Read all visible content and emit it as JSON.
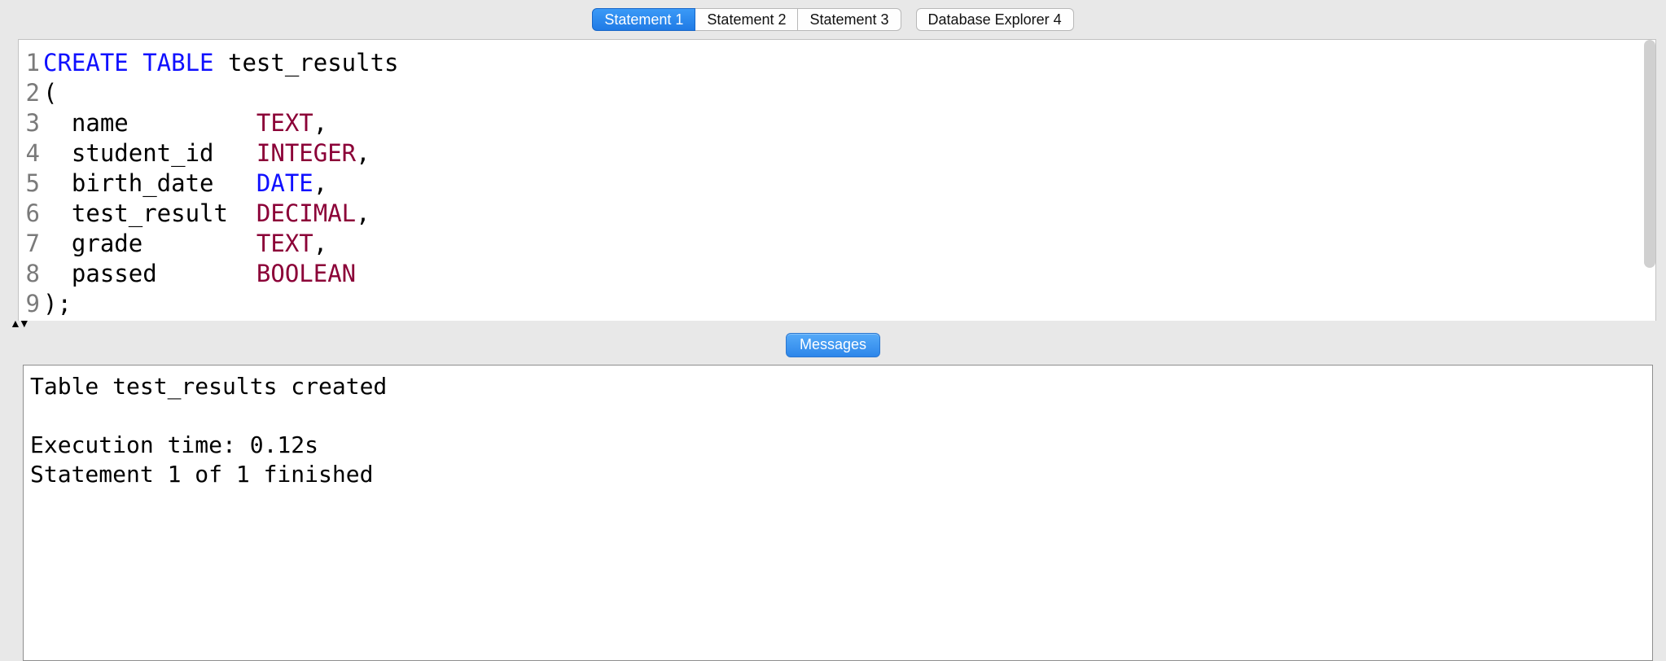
{
  "tabs": {
    "group1": [
      {
        "label": "Statement 1",
        "active": true
      },
      {
        "label": "Statement 2",
        "active": false
      },
      {
        "label": "Statement 3",
        "active": false
      }
    ],
    "group2": [
      {
        "label": "Database Explorer 4",
        "active": false
      }
    ]
  },
  "editor": {
    "line_numbers": [
      "1",
      "2",
      "3",
      "4",
      "5",
      "6",
      "7",
      "8",
      "9"
    ],
    "lines": [
      [
        {
          "t": "CREATE ",
          "c": "kw"
        },
        {
          "t": "TABLE ",
          "c": "kw"
        },
        {
          "t": "test_results",
          "c": ""
        }
      ],
      [
        {
          "t": "(",
          "c": ""
        }
      ],
      [
        {
          "t": "  name         ",
          "c": ""
        },
        {
          "t": "TEXT",
          "c": "type"
        },
        {
          "t": ",",
          "c": ""
        }
      ],
      [
        {
          "t": "  student_id   ",
          "c": ""
        },
        {
          "t": "INTEGER",
          "c": "type"
        },
        {
          "t": ",",
          "c": ""
        }
      ],
      [
        {
          "t": "  birth_date   ",
          "c": ""
        },
        {
          "t": "DATE",
          "c": "kw"
        },
        {
          "t": ",",
          "c": ""
        }
      ],
      [
        {
          "t": "  test_result  ",
          "c": ""
        },
        {
          "t": "DECIMAL",
          "c": "type"
        },
        {
          "t": ",",
          "c": ""
        }
      ],
      [
        {
          "t": "  grade        ",
          "c": ""
        },
        {
          "t": "TEXT",
          "c": "type"
        },
        {
          "t": ",",
          "c": ""
        }
      ],
      [
        {
          "t": "  passed       ",
          "c": ""
        },
        {
          "t": "BOOLEAN",
          "c": "type"
        }
      ],
      [
        {
          "t": ");",
          "c": ""
        }
      ]
    ]
  },
  "lower_tab": {
    "label": "Messages"
  },
  "output": {
    "lines": [
      "Table test_results created",
      "",
      "Execution time: 0.12s",
      "Statement 1 of 1 finished"
    ]
  }
}
